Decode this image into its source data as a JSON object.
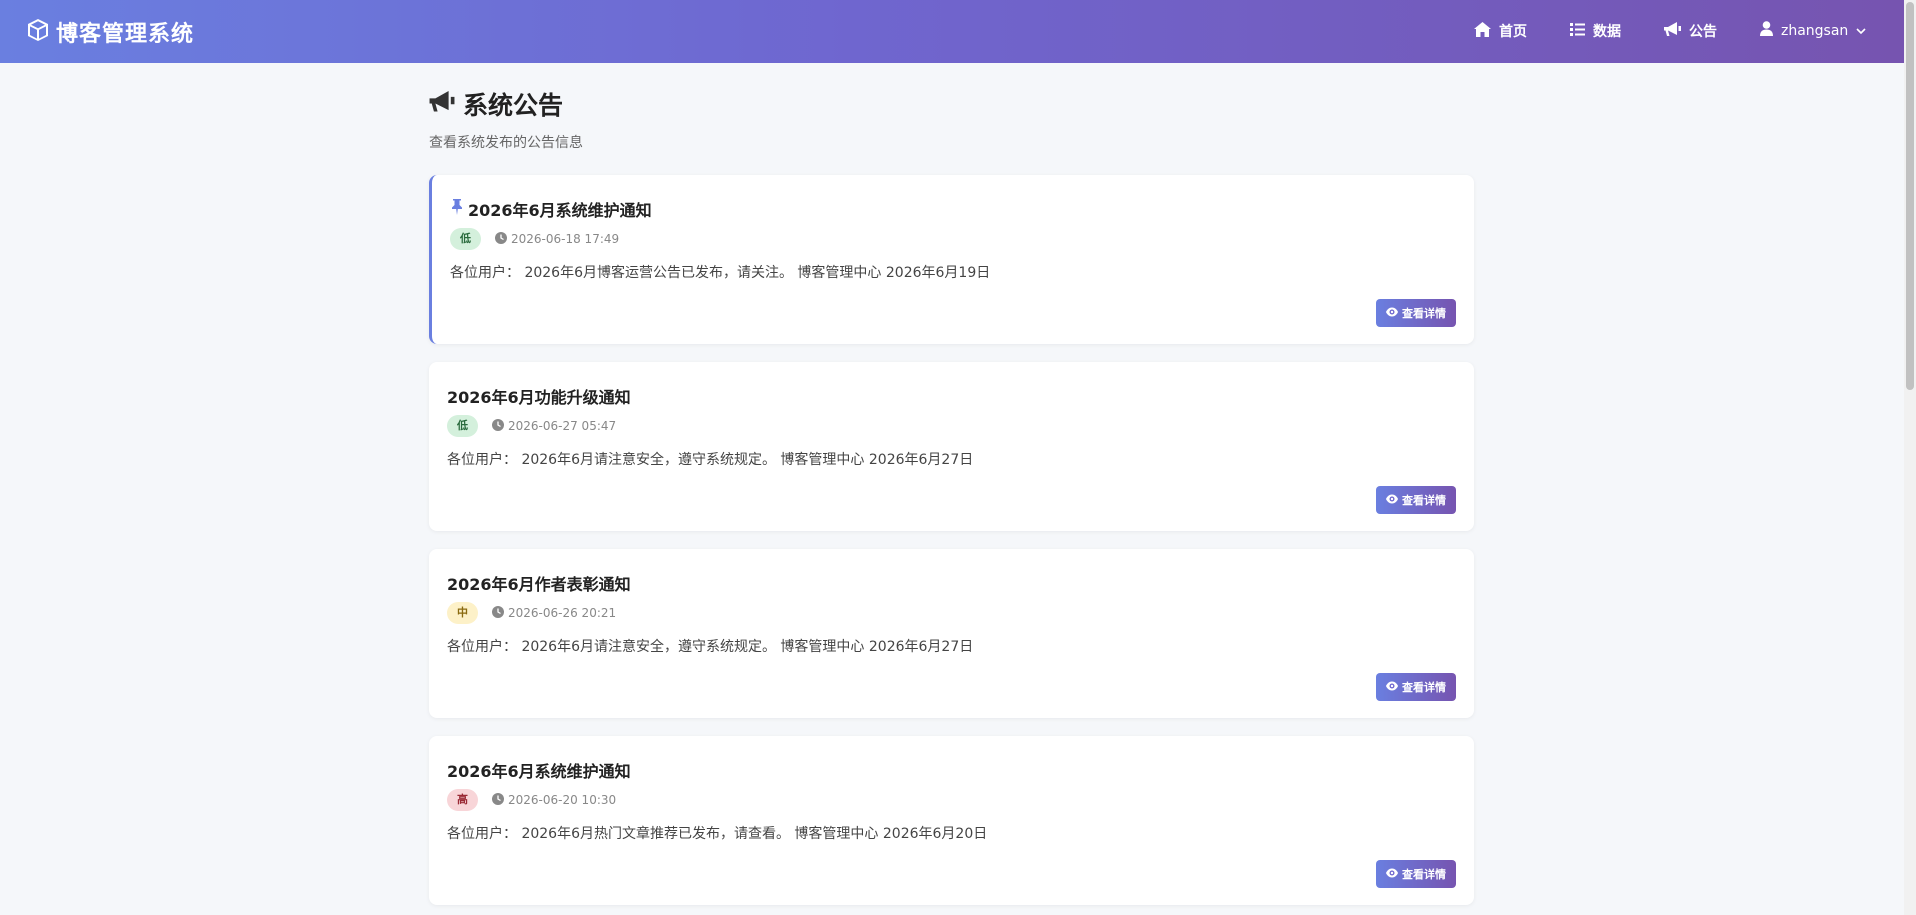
{
  "navbar": {
    "brand": "博客管理系统",
    "items": [
      {
        "label": "首页",
        "icon": "home-icon"
      },
      {
        "label": "数据",
        "icon": "list-icon"
      },
      {
        "label": "公告",
        "icon": "megaphone-icon"
      }
    ],
    "user": {
      "name": "zhangsan",
      "icon": "user-icon"
    }
  },
  "page": {
    "title": "系统公告",
    "subtitle": "查看系统发布的公告信息"
  },
  "detail_label": "查看详情",
  "announcements": [
    {
      "title": "2026年6月系统维护通知",
      "pinned": true,
      "priority": "低",
      "time": "2026-06-18 17:49",
      "content": "各位用户： 2026年6月博客运营公告已发布，请关注。 博客管理中心 2026年6月19日"
    },
    {
      "title": "2026年6月功能升级通知",
      "pinned": false,
      "priority": "低",
      "time": "2026-06-27 05:47",
      "content": "各位用户： 2026年6月请注意安全，遵守系统规定。 博客管理中心 2026年6月27日"
    },
    {
      "title": "2026年6月作者表彰通知",
      "pinned": false,
      "priority": "中",
      "time": "2026-06-26 20:21",
      "content": "各位用户： 2026年6月请注意安全，遵守系统规定。 博客管理中心 2026年6月27日"
    },
    {
      "title": "2026年6月系统维护通知",
      "pinned": false,
      "priority": "高",
      "time": "2026-06-20 10:30",
      "content": "各位用户： 2026年6月热门文章推荐已发布，请查看。 博客管理中心 2026年6月20日"
    }
  ],
  "colors": {
    "accent_start": "#6a7fe0",
    "accent_end": "#7654b0"
  }
}
